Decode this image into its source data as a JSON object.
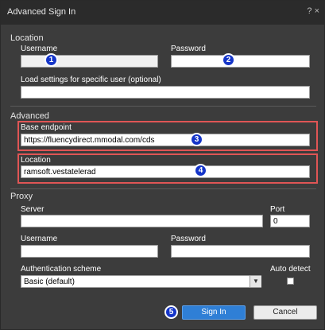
{
  "window": {
    "title": "Advanced Sign In",
    "controls": "? ×"
  },
  "location_section": {
    "label": "Location",
    "username_label": "Username",
    "username_value": "",
    "password_label": "Password",
    "password_value": "",
    "load_settings_label": "Load settings for specific user (optional)",
    "load_settings_value": ""
  },
  "advanced_section": {
    "label": "Advanced",
    "base_endpoint_label": "Base endpoint",
    "base_endpoint_value": "https://fluencydirect.mmodal.com/cds",
    "location_label": "Location",
    "location_value": "ramsoft.vestatelerad"
  },
  "proxy_section": {
    "label": "Proxy",
    "server_label": "Server",
    "server_value": "",
    "port_label": "Port",
    "port_value": "0",
    "username_label": "Username",
    "username_value": "",
    "password_label": "Password",
    "password_value": "",
    "auth_scheme_label": "Authentication scheme",
    "auth_scheme_value": "Basic (default)",
    "auto_detect_label": "Auto detect"
  },
  "buttons": {
    "sign_in": "Sign In",
    "cancel": "Cancel"
  },
  "badges": [
    "1",
    "2",
    "3",
    "4",
    "5"
  ],
  "colors": {
    "badge": "#1535c9",
    "highlight_border": "#e05555",
    "primary_button": "#2f7fd6"
  }
}
